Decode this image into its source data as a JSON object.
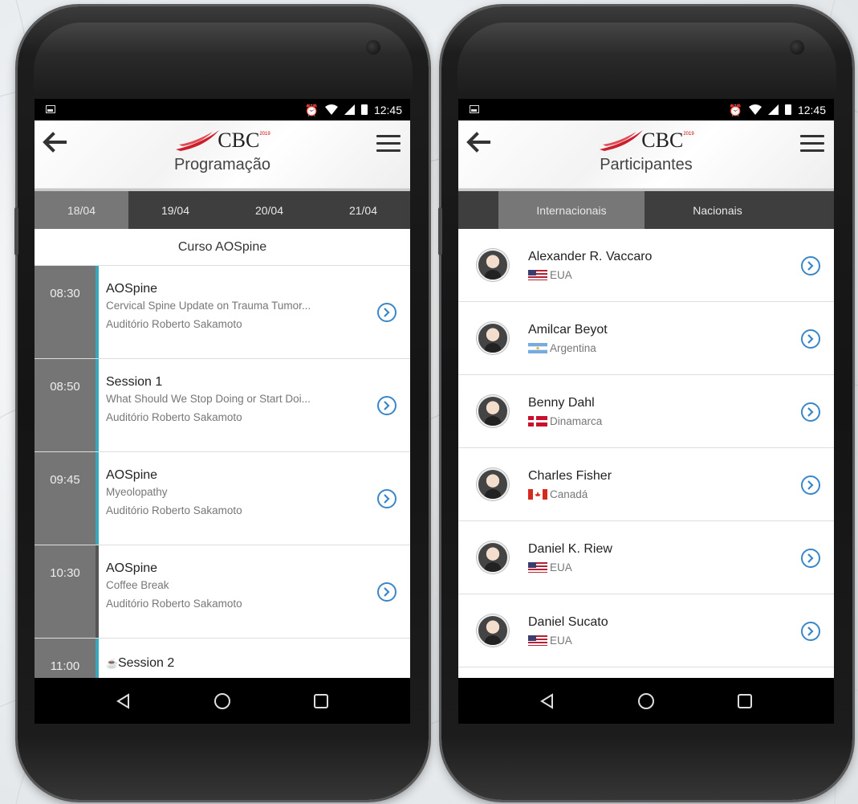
{
  "status": {
    "time": "12:45"
  },
  "left": {
    "title": "Programação",
    "logo_text": "CBC",
    "logo_small": "2019",
    "tabs": [
      "18/04",
      "19/04",
      "20/04",
      "21/04"
    ],
    "section": "Curso AOSpine",
    "events": [
      {
        "time": "08:30",
        "title": "AOSpine",
        "desc": "Cervical Spine Update on Trauma Tumor...",
        "place": "Auditório Roberto Sakamoto"
      },
      {
        "time": "08:50",
        "title": "Session 1",
        "desc": "What Should We Stop Doing or Start Doi...",
        "place": "Auditório Roberto Sakamoto"
      },
      {
        "time": "09:45",
        "title": "AOSpine",
        "desc": "Myeolopathy",
        "place": "Auditório Roberto Sakamoto"
      },
      {
        "time": "10:30",
        "title": "AOSpine",
        "desc": "Coffee Break",
        "place": "Auditório Roberto Sakamoto"
      },
      {
        "time": "11:00",
        "title": "Session 2",
        "desc": "",
        "place": ""
      }
    ]
  },
  "right": {
    "title": "Participantes",
    "logo_text": "CBC",
    "logo_small": "2019",
    "tabs": [
      "Internacionais",
      "Nacionais"
    ],
    "people": [
      {
        "name": "Alexander R. Vaccaro",
        "country": "EUA",
        "flag": "us"
      },
      {
        "name": "Amilcar Beyot",
        "country": "Argentina",
        "flag": "ar"
      },
      {
        "name": "Benny Dahl",
        "country": "Dinamarca",
        "flag": "dk"
      },
      {
        "name": "Charles Fisher",
        "country": "Canadá",
        "flag": "ca"
      },
      {
        "name": "Daniel K. Riew",
        "country": "EUA",
        "flag": "us"
      },
      {
        "name": "Daniel Sucato",
        "country": "EUA",
        "flag": "us"
      }
    ]
  },
  "colors": {
    "accent": "#3aa6b9",
    "link": "#3a86c8",
    "tab_bg": "#3e3e3e",
    "tab_active": "#777777",
    "logo_red": "#cc1f2d"
  },
  "icons": [
    "back-arrow-icon",
    "menu-icon",
    "chevron-right-circle-icon",
    "alarm-icon",
    "wifi-icon",
    "signal-icon",
    "battery-icon",
    "nav-back-icon",
    "nav-home-icon",
    "nav-recents-icon"
  ]
}
